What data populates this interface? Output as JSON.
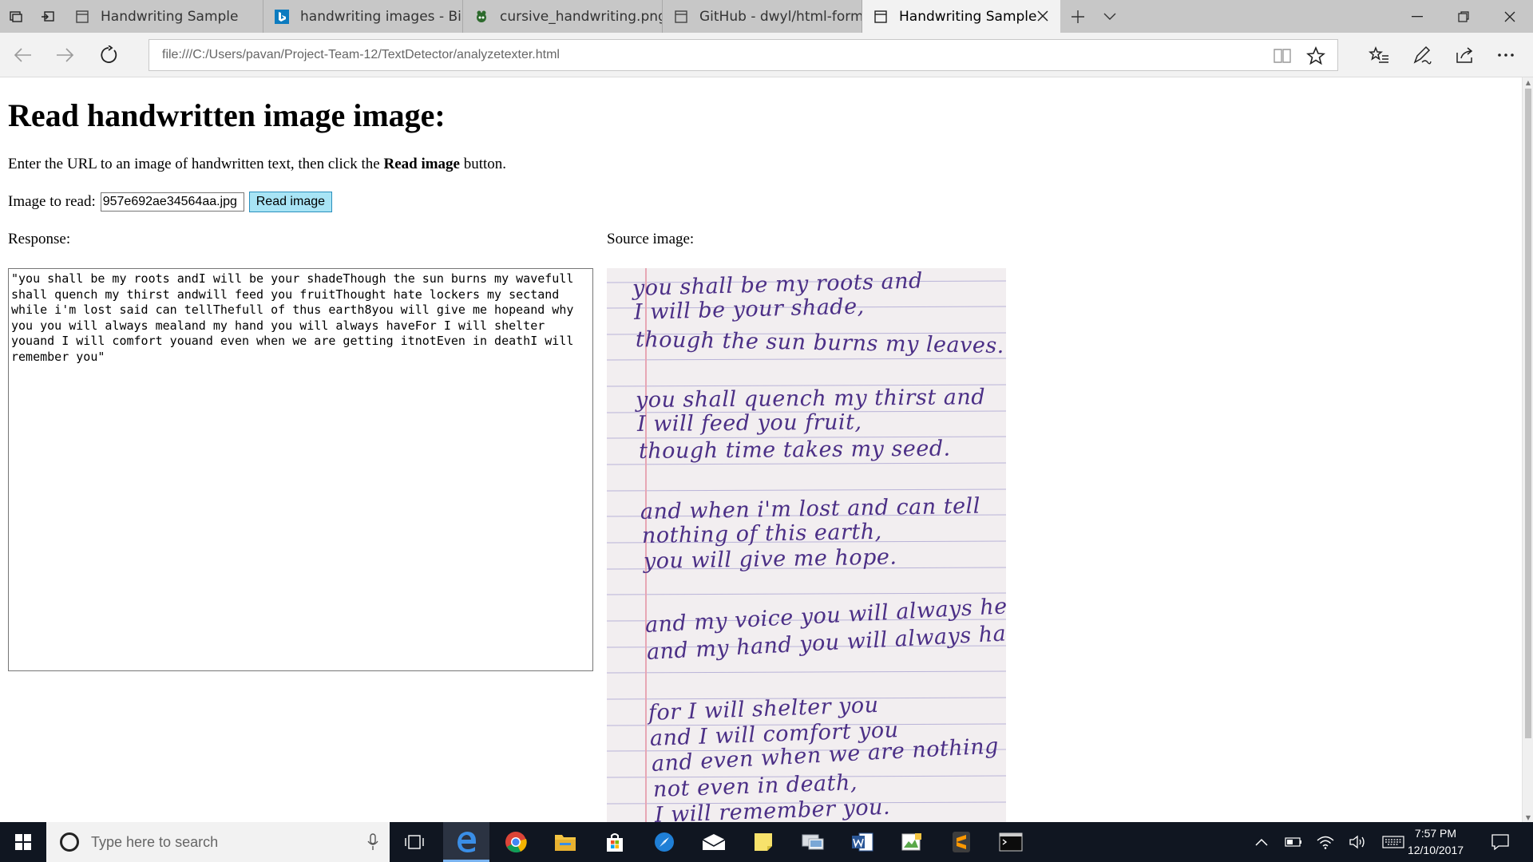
{
  "tabs": [
    {
      "title": "Handwriting Sample",
      "icon": "page-icon",
      "active": false
    },
    {
      "title": "handwriting images - Bing i",
      "icon": "bing-icon",
      "active": false
    },
    {
      "title": "cursive_handwriting.png",
      "icon": "bug-icon",
      "active": false
    },
    {
      "title": "GitHub - dwyl/html-form-se",
      "icon": "page-icon",
      "active": false
    },
    {
      "title": "Handwriting Sample",
      "icon": "page-icon",
      "active": true
    }
  ],
  "address_bar": {
    "url": "file:///C:/Users/pavan/Project-Team-12/TextDetector/analyzetexter.html"
  },
  "page": {
    "heading": "Read handwritten image image:",
    "intro_prefix": "Enter the URL to an image of handwritten text, then click the ",
    "intro_bold": "Read image",
    "intro_suffix": " button.",
    "input_label": "Image to read:",
    "input_value": "957e692ae34564aa.jpg",
    "read_button": "Read image",
    "response_label": "Response:",
    "source_label": "Source image:",
    "response_text": "\"you shall be my roots andI will be your shadeThough the sun burns my wavefull shall quench my thirst andwill feed you fruitThought hate lockers my sectand while i'm lost said can tellThefull of thus earth8you will give me hopeand why you you will always mealand my hand you will always haveFor I will shelter youand I will comfort youand even when we are getting itnotEven in deathI will remember you\""
  },
  "source_image_lines": [
    "you shall be my roots and",
    "I will be your shade,",
    "though the sun burns my leaves.",
    "you shall quench my thirst and",
    "I will feed you fruit,",
    "though time takes my seed.",
    "and when i'm lost and can tell",
    "nothing of this earth,",
    "you will give me hope.",
    "and my voice you will always hear",
    "and my hand you will always have",
    "for I will shelter you",
    "and I will comfort you",
    "and even when we are nothing left,",
    "not even in death,",
    "I will remember you."
  ],
  "taskbar": {
    "search_placeholder": "Type here to search",
    "time": "7:57 PM",
    "date": "12/10/2017"
  },
  "colors": {
    "tabstrip": "#c7c7c7",
    "active_tab": "#f2f2f2",
    "button_bg": "#a8e4f5",
    "taskbar": "#101621",
    "ink": "#4b2f86"
  }
}
